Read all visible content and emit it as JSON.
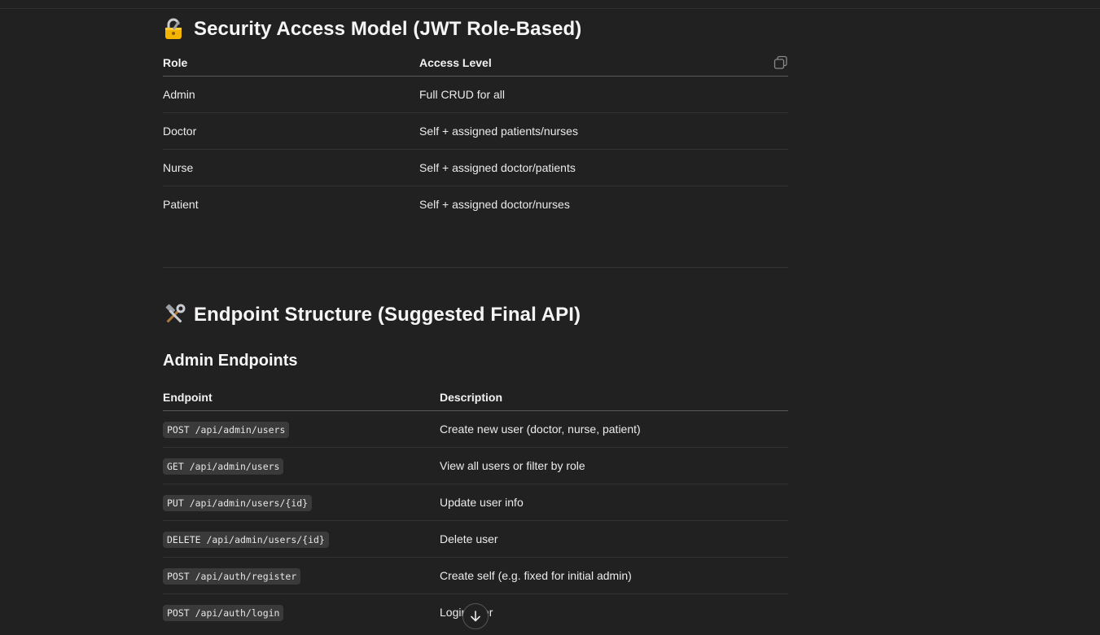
{
  "security": {
    "title": "Security Access Model (JWT Role-Based)",
    "icon": "lock-with-key-icon",
    "headers": [
      "Role",
      "Access Level"
    ],
    "rows": [
      [
        "Admin",
        "Full CRUD for all"
      ],
      [
        "Doctor",
        "Self + assigned patients/nurses"
      ],
      [
        "Nurse",
        "Self + assigned doctor/patients"
      ],
      [
        "Patient",
        "Self + assigned doctor/nurses"
      ]
    ]
  },
  "endpoints": {
    "title": "Endpoint Structure (Suggested Final API)",
    "icon": "hammer-and-wrench-icon",
    "admin": {
      "title": "Admin Endpoints",
      "headers": [
        "Endpoint",
        "Description"
      ],
      "rows": [
        [
          "POST /api/admin/users",
          "Create new user (doctor, nurse, patient)"
        ],
        [
          "GET /api/admin/users",
          "View all users or filter by role"
        ],
        [
          "PUT /api/admin/users/{id}",
          "Update user info"
        ],
        [
          "DELETE /api/admin/users/{id}",
          "Delete user"
        ],
        [
          "POST /api/auth/register",
          "Create self (e.g. fixed for initial admin)"
        ],
        [
          "POST /api/auth/login",
          "Login user"
        ]
      ]
    }
  },
  "colors": {
    "background": "#212121",
    "text": "#ececec",
    "code_bg": "#3a3a3a"
  }
}
